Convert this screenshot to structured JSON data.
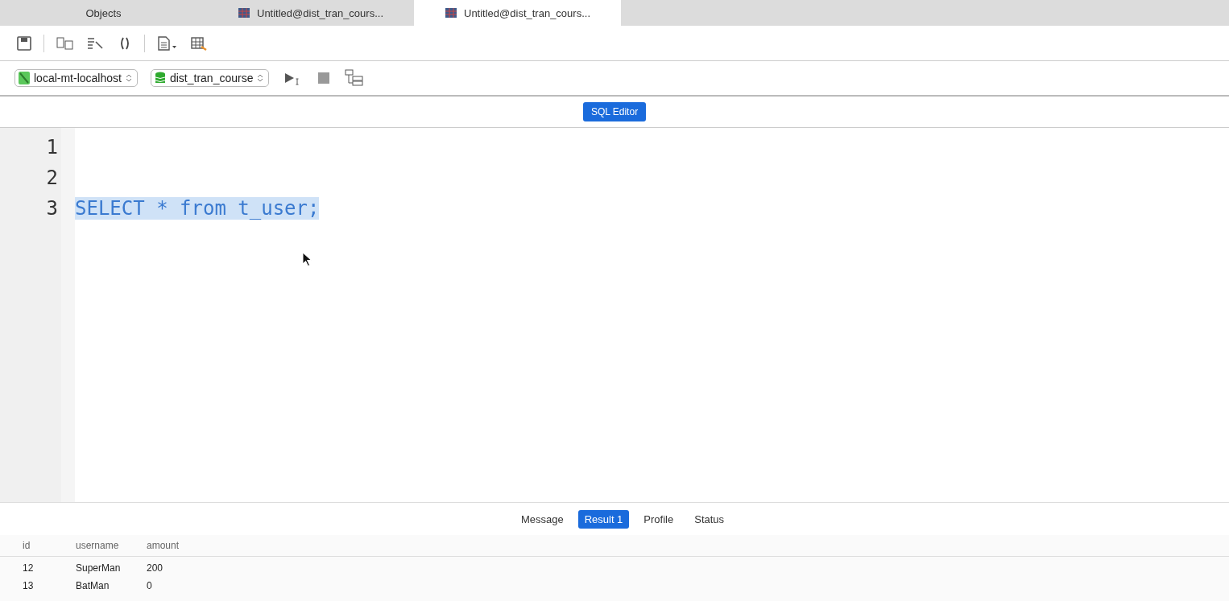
{
  "tabs": [
    {
      "label": "Objects",
      "kind": "objects",
      "selected": false
    },
    {
      "label": "Untitled@dist_tran_cours...",
      "kind": "query",
      "selected": false
    },
    {
      "label": "Untitled@dist_tran_cours...",
      "kind": "query",
      "selected": true
    }
  ],
  "connection": {
    "server": "local-mt-localhost",
    "database": "dist_tran_course"
  },
  "editor": {
    "title": "SQL Editor",
    "lines": [
      {
        "number": "1"
      },
      {
        "number": "2"
      },
      {
        "number": "3",
        "text": "SELECT * from t_user;",
        "highlighted": true
      }
    ]
  },
  "result_tabs": [
    {
      "label": "Message",
      "selected": false
    },
    {
      "label": "Result 1",
      "selected": true
    },
    {
      "label": "Profile",
      "selected": false
    },
    {
      "label": "Status",
      "selected": false
    }
  ],
  "table": {
    "columns": [
      "id",
      "username",
      "amount"
    ],
    "rows": [
      [
        "12",
        "SuperMan",
        "200"
      ],
      [
        "13",
        "BatMan",
        "0"
      ]
    ]
  }
}
